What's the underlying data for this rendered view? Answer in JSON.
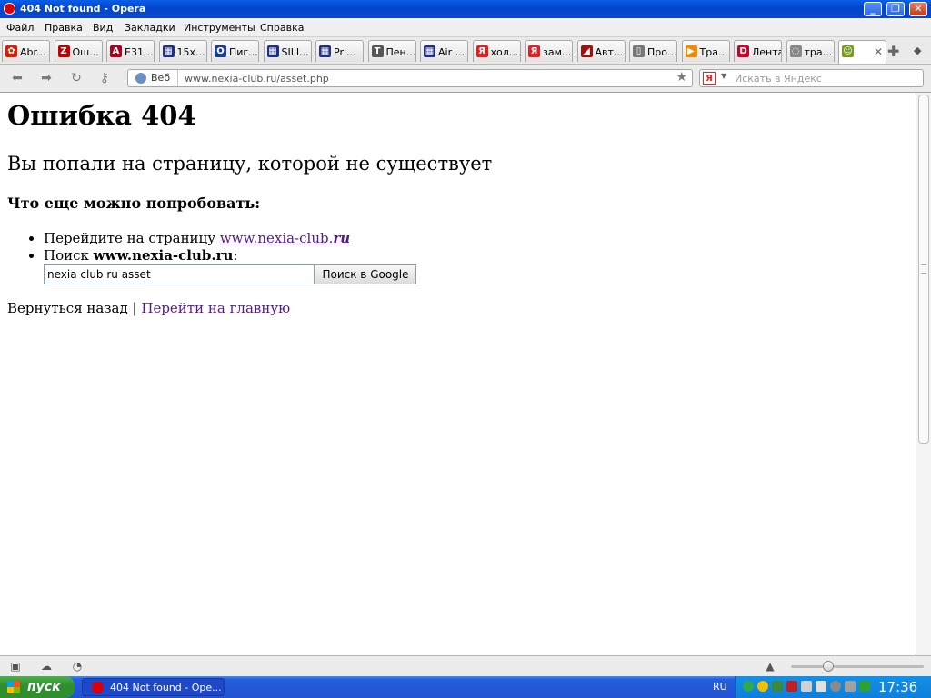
{
  "window": {
    "title": "404 Not found - Opera"
  },
  "menu": [
    "Файл",
    "Правка",
    "Вид",
    "Закладки",
    "Инструменты",
    "Справка"
  ],
  "tabs": [
    {
      "label": "Abr...",
      "color": "#d81e05",
      "glyph": "✿"
    },
    {
      "label": "Ош...",
      "color": "#c00000",
      "glyph": "Z"
    },
    {
      "label": "E31...",
      "color": "#b00020",
      "glyph": "A"
    },
    {
      "label": "15x...",
      "color": "#203080",
      "glyph": "▦"
    },
    {
      "label": "Пиг...",
      "color": "#1b3f8f",
      "glyph": "O"
    },
    {
      "label": "SILI...",
      "color": "#203080",
      "glyph": "▦"
    },
    {
      "label": "Pri...",
      "color": "#203080",
      "glyph": "▦"
    },
    {
      "label": "Пен...",
      "color": "#555555",
      "glyph": "T"
    },
    {
      "label": "Air ...",
      "color": "#203080",
      "glyph": "▦"
    },
    {
      "label": "хол...",
      "color": "#e22222",
      "glyph": "Я"
    },
    {
      "label": "зам...",
      "color": "#e22222",
      "glyph": "Я"
    },
    {
      "label": "Авт...",
      "color": "#a01010",
      "glyph": "◢"
    },
    {
      "label": "Про...",
      "color": "#777777",
      "glyph": "▯"
    },
    {
      "label": "Тра...",
      "color": "#f08a00",
      "glyph": "▶"
    },
    {
      "label": "Лента",
      "color": "#d0002a",
      "glyph": "D"
    },
    {
      "label": "тра...",
      "color": "#888888",
      "glyph": "◌"
    },
    {
      "label": "",
      "color": "#7a9a20",
      "glyph": "☺"
    }
  ],
  "nav": {
    "web_label": "Веб",
    "url_host": "www.nexia-club.ru",
    "url_path": "/asset.php",
    "search_placeholder": "Искать в Яндекс"
  },
  "page": {
    "h1": "Ошибка 404",
    "h2": "Вы попали на страницу, которой не существует",
    "h3": "Что еще можно попробовать:",
    "item1_prefix": "Перейдите на страницу ",
    "item1_link_main": "www.nexia-club.",
    "item1_link_tld": "ru",
    "item2_prefix": "Поиск ",
    "item2_bold": "www.nexia-club.ru",
    "item2_suffix": ":",
    "search_value": "nexia club ru asset",
    "search_button": "Поиск в Google",
    "back_link": "Вернуться назад",
    "separator": "|",
    "home_link": "Перейти на главную"
  },
  "taskbar": {
    "start": "пуск",
    "task": "404 Not found - Ope...",
    "lang": "RU",
    "clock": "17:36"
  }
}
